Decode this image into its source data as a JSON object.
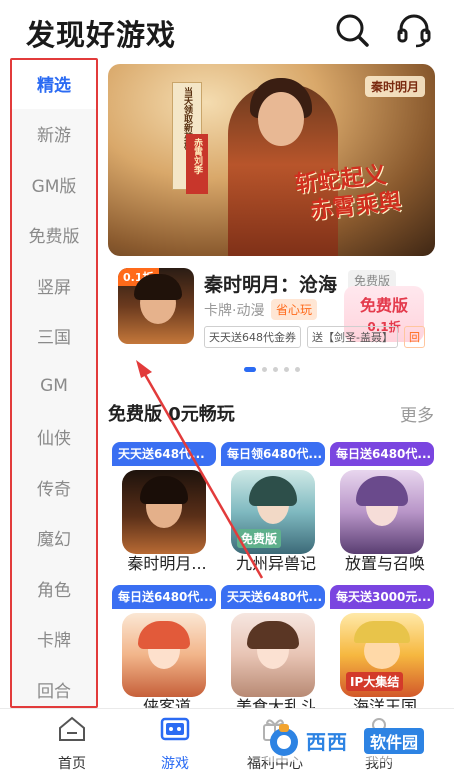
{
  "header": {
    "title": "发现好游戏"
  },
  "sidebar": {
    "items": [
      {
        "label": "精选"
      },
      {
        "label": "新游"
      },
      {
        "label": "GM版"
      },
      {
        "label": "免费版"
      },
      {
        "label": "竖屏"
      },
      {
        "label": "三国"
      },
      {
        "label": "GM"
      },
      {
        "label": "仙侠"
      },
      {
        "label": "传奇"
      },
      {
        "label": "魔幻"
      },
      {
        "label": "角色"
      },
      {
        "label": "卡牌"
      },
      {
        "label": "回合"
      }
    ]
  },
  "banner": {
    "slogan_line1": "斩蛇起义",
    "slogan_line2": "赤霄乘舆",
    "logo": "秦时明月",
    "scroll_text": "当天领取新英雄",
    "scroll_red_text": "赤霄刘季"
  },
  "featured": {
    "badge": "0.1折",
    "title": "秦时明月：沧海",
    "genre": "卡牌·动漫",
    "tag": "省心玩",
    "chips": [
      "天天送648代金券",
      "送【剑圣-盖聂】",
      "回"
    ],
    "version_badge": "免费版",
    "stamp_main": "免费版",
    "stamp_sub": "0.1折"
  },
  "section": {
    "title": "免费版 0元畅玩",
    "more": "更多"
  },
  "games": [
    {
      "promo": "天天送648代...",
      "name": "秦时明月...",
      "promo_color": "#3a6ff2"
    },
    {
      "promo": "每日领6480代...",
      "name": "九州异兽记",
      "promo_color": "#3a6ff2"
    },
    {
      "promo": "每日送6480代...",
      "name": "放置与召唤",
      "promo_color": "#7a45e0"
    },
    {
      "promo": "每日送6480代...",
      "name": "侠客道",
      "promo_color": "#3a6ff2"
    },
    {
      "promo": "天天送6480代...",
      "name": "美食大乱斗",
      "promo_color": "#3a6ff2"
    },
    {
      "promo": "每天送3000元...",
      "name": "海洋王国",
      "promo_color": "#7a45e0"
    }
  ],
  "game_art_labels": {
    "game2": "免费版",
    "game6": "IP大集结"
  },
  "nav": {
    "items": [
      {
        "label": "首页"
      },
      {
        "label": "游戏"
      },
      {
        "label": "福利中心"
      },
      {
        "label": "我的"
      }
    ]
  },
  "watermark": {
    "text": "西西",
    "sub": "软件园"
  },
  "colors": {
    "accent": "#2b6bf3",
    "highlight_border": "#e23b3b",
    "orange": "#ff6a1a"
  },
  "icons": [
    "search-icon",
    "headset-icon",
    "home-icon",
    "gamepad-icon",
    "gift-icon",
    "profile-icon"
  ]
}
